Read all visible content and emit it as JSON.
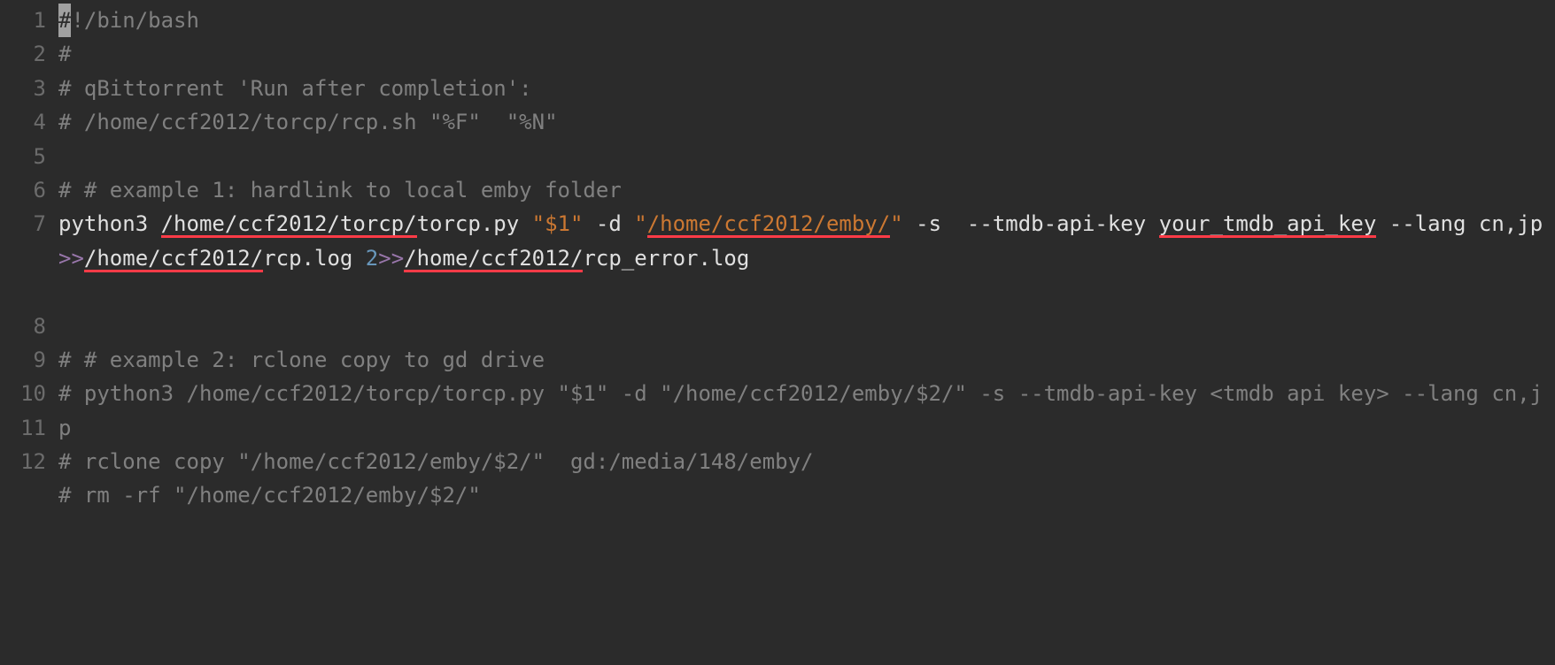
{
  "editor": {
    "gutter": [
      "1",
      "2",
      "3",
      "4",
      "5",
      "6",
      "7",
      "",
      "",
      "8",
      "9",
      "10",
      "11",
      "12"
    ],
    "lines": {
      "l1": {
        "hash_cursor": "#",
        "rest": "!/bin/bash"
      },
      "l2": "#",
      "l3": "# qBittorrent 'Run after completion':",
      "l4": "# /home/ccf2012/torcp/rcp.sh \"%F\"  \"%N\"",
      "l5": "",
      "l6": "# # example 1: hardlink to local emby folder",
      "l7": {
        "p_python": "python3 ",
        "p_torcp_path": "/home/ccf2012/torcp/",
        "p_torcp_file": "torcp.py ",
        "p_arg1": "\"$1\"",
        "p_dflag": " -d ",
        "p_dq1": "\"",
        "p_emby_path": "/home/ccf2012/emby/",
        "p_dq2": "\"",
        "p_sflag": " -s ",
        "p_tmdbflag": " --tmdb-api-key ",
        "p_apikey": "your_tmdb_api_key",
        "p_langflag": " --lang ",
        "p_langval": "cn,jp  ",
        "p_redir1": ">>",
        "p_log1_dir": "/home/ccf2012/",
        "p_log1_file": "rcp.log ",
        "p_fd2": "2",
        "p_redir2": ">>",
        "p_log2_dir": "/home/ccf2012/",
        "p_log2_file": "rcp_error.log"
      },
      "l8": "",
      "l9": "# # example 2: rclone copy to gd drive",
      "l10": "# python3 /home/ccf2012/torcp/torcp.py \"$1\" -d \"/home/ccf2012/emby/$2/\" -s --tmdb-api-key <tmdb api key> --lang cn,jp",
      "l11": "# rclone copy \"/home/ccf2012/emby/$2/\"  gd:/media/148/emby/",
      "l12": "# rm -rf \"/home/ccf2012/emby/$2/\""
    }
  },
  "chart_data": null
}
